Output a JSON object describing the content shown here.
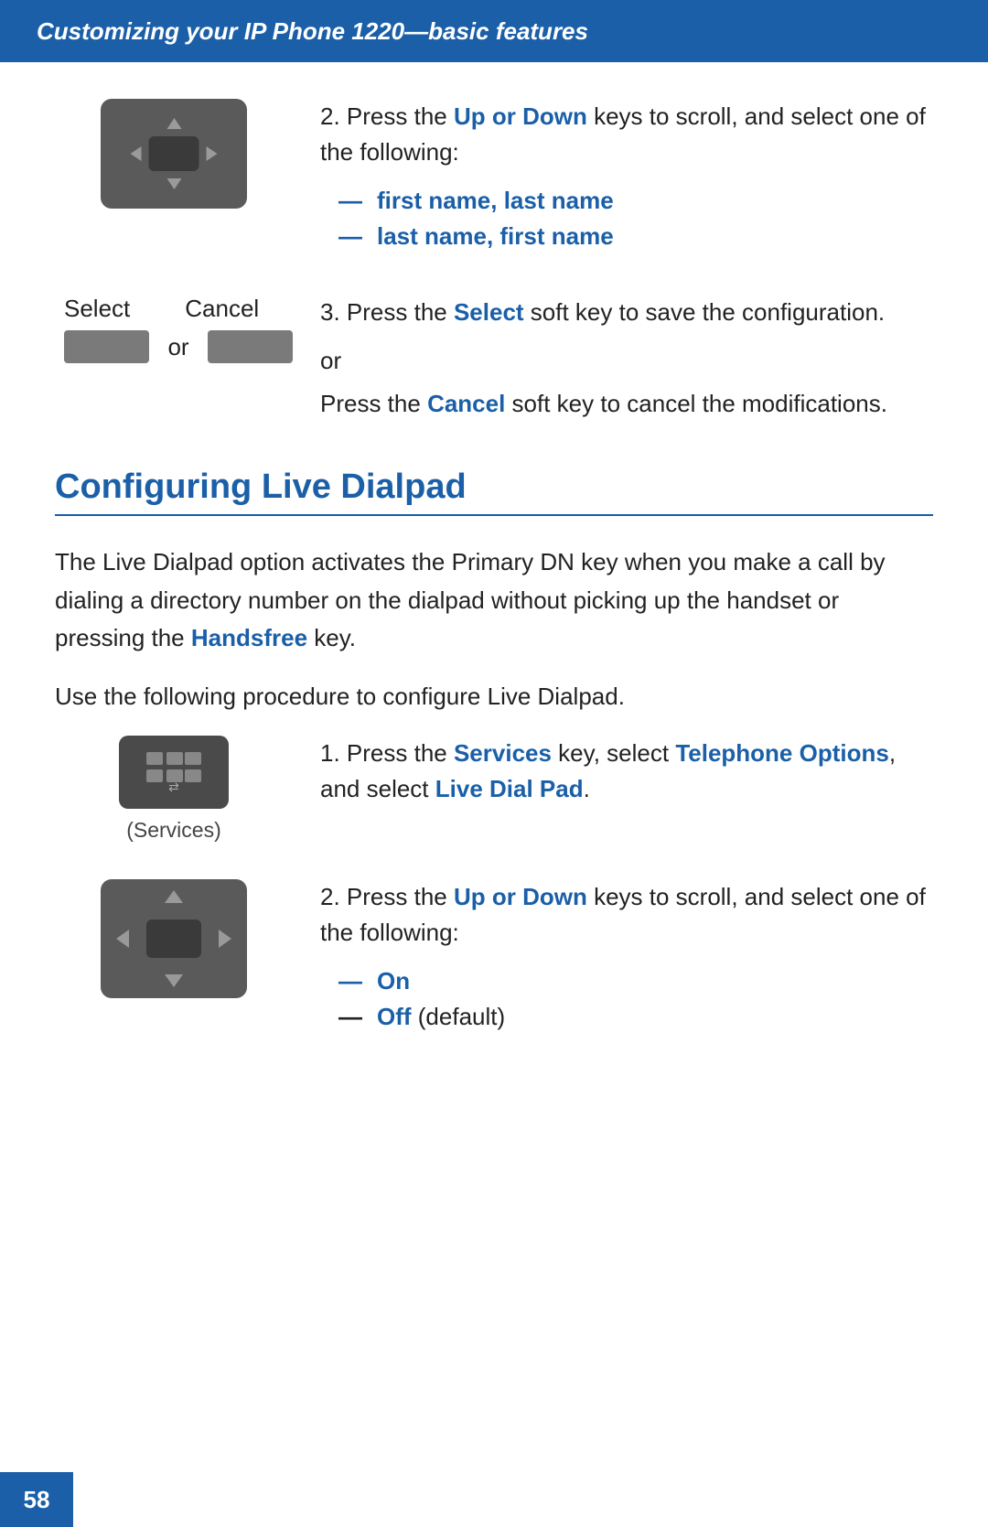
{
  "header": {
    "title": "Customizing your IP Phone 1220—basic features"
  },
  "section1": {
    "step2_prefix": "2.  Press the ",
    "step2_key": "Up or Down",
    "step2_suffix": " keys to scroll, and select one of the following:",
    "option1_dash": "—",
    "option1_label": "first name, last name",
    "option2_dash": "—",
    "option2_label": "last name, first name",
    "step3_prefix": "3.  Press the ",
    "step3_key": "Select",
    "step3_suffix": " soft key to save the configuration.",
    "or1": "or",
    "cancel_prefix": "Press the ",
    "cancel_key": "Cancel",
    "cancel_suffix": " soft key to cancel the modifications.",
    "select_label": "Select",
    "cancel_label": "Cancel",
    "or_label": "or"
  },
  "section2": {
    "heading": "Configuring Live Dialpad",
    "desc1": "The Live Dialpad option activates the Primary DN key when you make a call by dialing a directory number on the dialpad without picking up the handset or pressing the ",
    "desc1_key": "Handsfree",
    "desc1_end": " key.",
    "desc2": "Use the following procedure to configure Live Dialpad.",
    "step1_prefix": "1.  Press the ",
    "step1_key1": "Services",
    "step1_mid": " key, select ",
    "step1_key2": "Telephone Options",
    "step1_end1": ", and select ",
    "step1_key3": "Live Dial Pad",
    "step1_end2": ".",
    "services_caption": "(Services)",
    "step2_prefix": "2.  Press the ",
    "step2_key": "Up or Down",
    "step2_suffix": " keys to scroll, and select one of the following:",
    "option_on_dash": "—",
    "option_on_label": "On",
    "option_off_dash": "—",
    "option_off_label": "Off",
    "option_off_suffix": " (default)"
  },
  "footer": {
    "page_number": "58"
  }
}
